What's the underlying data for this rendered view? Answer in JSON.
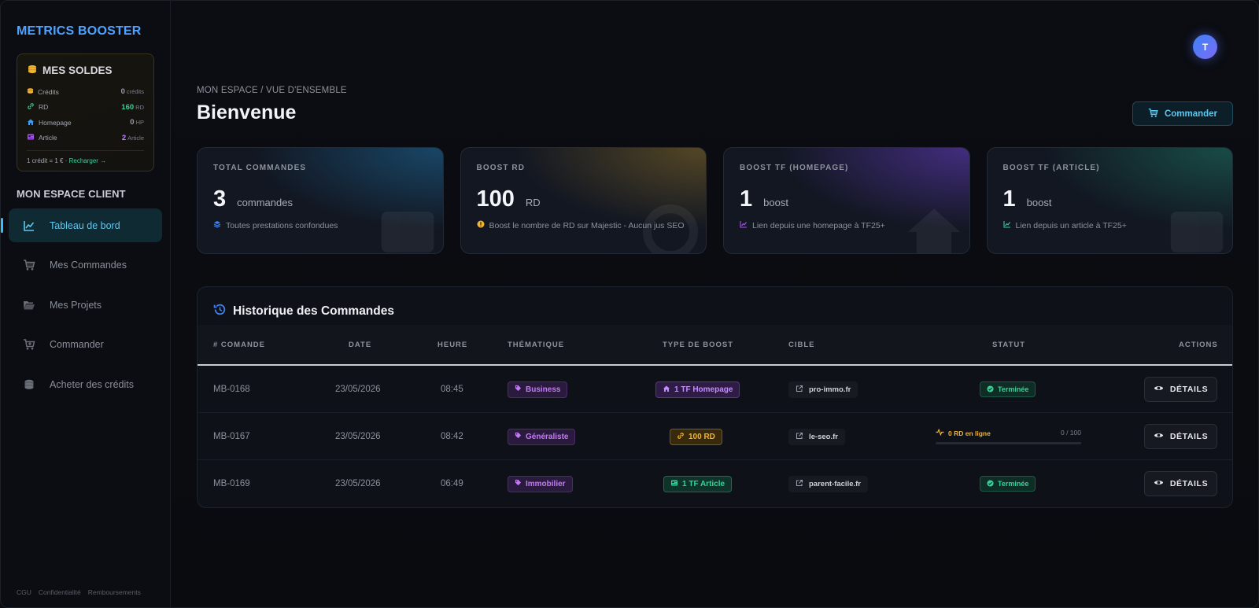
{
  "brand": "METRICS BOOSTER",
  "soldes": {
    "title": "MES SOLDES",
    "rows": [
      {
        "label": "Crédits",
        "value": "0",
        "unit": "crédits",
        "color": "#9aa0ab"
      },
      {
        "label": "RD",
        "value": "160",
        "unit": "RD",
        "color": "#34d399"
      },
      {
        "label": "Homepage",
        "value": "0",
        "unit": "HP",
        "color": "#9aa0ab"
      },
      {
        "label": "Article",
        "value": "2",
        "unit": "Article",
        "color": "#c084fc"
      }
    ],
    "rate": "1 crédit = 1 € ·",
    "recharge": "Recharger →"
  },
  "section_label": "MON ESPACE CLIENT",
  "nav": [
    {
      "label": "Tableau de bord",
      "icon": "chart-line-icon",
      "active": true
    },
    {
      "label": "Mes Commandes",
      "icon": "cart-icon",
      "active": false
    },
    {
      "label": "Mes Projets",
      "icon": "folder-open-icon",
      "active": false
    },
    {
      "label": "Commander",
      "icon": "cart-plus-icon",
      "active": false
    },
    {
      "label": "Acheter des crédits",
      "icon": "coins-icon",
      "active": false
    }
  ],
  "footer_links": [
    "CGU",
    "Confidentialité",
    "Remboursements"
  ],
  "avatar_initials": "T",
  "breadcrumb": "MON ESPACE / VUE D'ENSEMBLE",
  "page_title": "Bienvenue",
  "commander_button": "Commander",
  "cards": [
    {
      "label": "TOTAL COMMANDES",
      "value": "3",
      "unit": "commandes",
      "desc": "Toutes prestations confondues",
      "accent": "#3b82f6"
    },
    {
      "label": "BOOST RD",
      "value": "100",
      "unit": "RD",
      "desc": "Boost le nombre de RD sur Majestic - Aucun jus SEO",
      "accent": "#f0b432"
    },
    {
      "label": "BOOST TF (HOMEPAGE)",
      "value": "1",
      "unit": "boost",
      "desc": "Lien depuis une homepage à TF25+",
      "accent": "#a855f7"
    },
    {
      "label": "BOOST TF (ARTICLE)",
      "value": "1",
      "unit": "boost",
      "desc": "Lien depuis un article à TF25+",
      "accent": "#34d399"
    }
  ],
  "history": {
    "title": "Historique des Commandes",
    "columns": [
      "# COMANDE",
      "DATE",
      "HEURE",
      "THÉMATIQUE",
      "TYPE DE BOOST",
      "CIBLE",
      "STATUT",
      "ACTIONS"
    ],
    "rows": [
      {
        "id": "MB-0168",
        "date": "23/05/2026",
        "time": "08:45",
        "theme": "Business",
        "boost": "1 TF Homepage",
        "boost_kind": "hp",
        "cible": "pro-immo.fr",
        "status": "Terminée",
        "action": "DÉTAILS"
      },
      {
        "id": "MB-0167",
        "date": "23/05/2026",
        "time": "08:42",
        "theme": "Généraliste",
        "boost": "100 RD",
        "boost_kind": "rd",
        "cible": "le-seo.fr",
        "progress_label": "0 RD en ligne",
        "progress_count": "0 / 100",
        "progress_fraction": 0,
        "action": "DÉTAILS"
      },
      {
        "id": "MB-0169",
        "date": "23/05/2026",
        "time": "06:49",
        "theme": "Immobilier",
        "boost": "1 TF Article",
        "boost_kind": "art",
        "cible": "parent-facile.fr",
        "status": "Terminée",
        "action": "DÉTAILS"
      }
    ]
  }
}
